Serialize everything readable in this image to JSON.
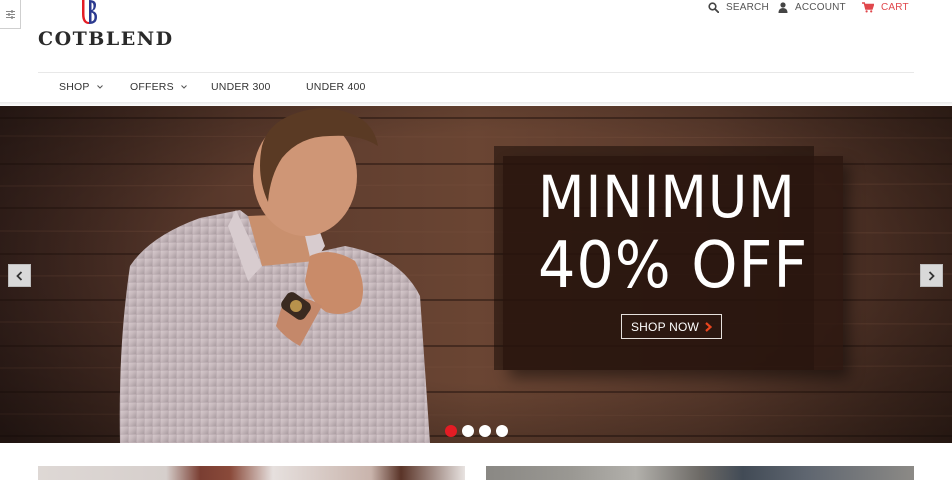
{
  "brand": {
    "name": "COTBLEND",
    "colors": {
      "logo_red": "#e41c24",
      "logo_blue": "#2b3a8f"
    }
  },
  "utility_links": {
    "search": {
      "label": "SEARCH",
      "icon": "search-icon"
    },
    "account": {
      "label": "ACCOUNT",
      "icon": "user-icon"
    },
    "cart": {
      "label": "CART",
      "icon": "cart-icon",
      "color": "#e0474c"
    }
  },
  "nav": {
    "items": [
      {
        "label": "SHOP",
        "has_dropdown": true
      },
      {
        "label": "OFFERS",
        "has_dropdown": true
      },
      {
        "label": "UNDER 300",
        "has_dropdown": false
      },
      {
        "label": "UNDER 400",
        "has_dropdown": false
      }
    ]
  },
  "hero": {
    "headline_line1": "MINIMUM",
    "headline_line2": "40% OFF",
    "cta_label": "SHOP NOW",
    "cta_arrow_color": "#e8451e",
    "prev_icon": "chevron-left-icon",
    "next_icon": "chevron-right-icon",
    "slides_count": 4,
    "active_slide": 1,
    "active_dot_color": "#e41c24"
  },
  "side_panel": {
    "icon": "filter-sliders-icon"
  }
}
